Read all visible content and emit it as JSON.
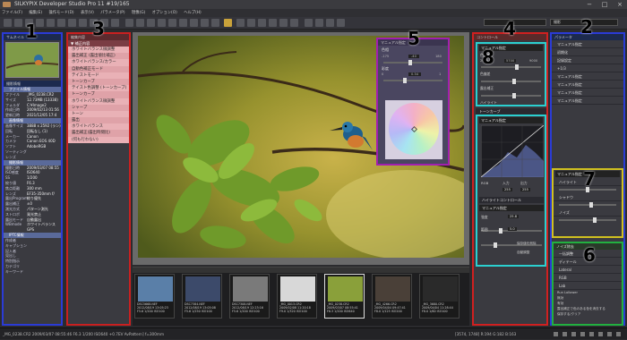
{
  "window": {
    "title": "SILKYPIX Developer Studio Pro 11  #19/165",
    "minimize": "−",
    "maximize": "□",
    "close": "×"
  },
  "menu": [
    "ファイル(F)",
    "編集(E)",
    "操作モード(D)",
    "表示(V)",
    "パラメータ(P)",
    "現像(G)",
    "オプション(O)",
    "ヘルプ(H)"
  ],
  "toolbar": {
    "combo_left": "",
    "combo_right": "撮影"
  },
  "callouts": [
    "1",
    "2",
    "3",
    "4",
    "5",
    "6",
    "7",
    "8"
  ],
  "thumbnail_panel": {
    "header": "サムネイル"
  },
  "info_panel": {
    "header": "撮影情報",
    "file_section": "ファイル情報",
    "file_rows": [
      {
        "k": "ファイル",
        "v": "_MG_0238.CR2"
      },
      {
        "k": "サイズ",
        "v": "12.73MB (13338)"
      },
      {
        "k": "フォルダ",
        "v": "C:¥Image2"
      },
      {
        "k": "作成日時",
        "v": "2009/02/13 01:56"
      },
      {
        "k": "更新日時",
        "v": "2021/12/05 17:4"
      }
    ],
    "image_section": "画像情報",
    "image_rows": [
      {
        "k": "画像サイズ",
        "v": "3888 x 2592 (ラン)"
      },
      {
        "k": "回転",
        "v": "回転なし (1)"
      },
      {
        "k": "メーカー",
        "v": "Canon"
      },
      {
        "k": "カメラ",
        "v": "Canon EOS 40D"
      },
      {
        "k": "ソフト",
        "v": "AdobeRGB"
      },
      {
        "k": "ソーティング",
        "v": ""
      },
      {
        "k": "レンズ",
        "v": ""
      }
    ],
    "shoot_section": "撮影情報",
    "shoot_rows": [
      {
        "k": "撮影日時",
        "v": "2009/03/07 08:55"
      },
      {
        "k": "ISO感度",
        "v": "ISO640"
      },
      {
        "k": "SS",
        "v": "1/200"
      },
      {
        "k": "絞り値",
        "v": "F6.3"
      },
      {
        "k": "焦点距離",
        "v": "300 mm"
      },
      {
        "k": "レンズ",
        "v": "EF35-350mm f/"
      },
      {
        "k": "露出Program",
        "v": "絞り優先"
      },
      {
        "k": "露出補正",
        "v": "±0"
      },
      {
        "k": "測光方式",
        "v": "パターン測光"
      },
      {
        "k": "ストロボ",
        "v": "発光禁止"
      },
      {
        "k": "露出モード",
        "v": "自動露出"
      },
      {
        "k": "WBmode",
        "v": "ホワイトバランス"
      },
      {
        "k": "",
        "v": "GPS"
      }
    ],
    "custom_section": "IPTC情報",
    "custom_rows": [
      {
        "k": "作成者",
        "v": ""
      },
      {
        "k": "キャプション",
        "v": ""
      },
      {
        "k": "記入者",
        "v": ""
      },
      {
        "k": "見出し",
        "v": ""
      },
      {
        "k": "特別指示",
        "v": ""
      },
      {
        "k": "カテゴリ",
        "v": ""
      },
      {
        "k": "キーワード",
        "v": ""
      }
    ]
  },
  "tree_panel": {
    "header": "編集内容",
    "subheader": "▼ 補正内容",
    "items": [
      "ホワイトバランス微調整",
      "露出補正 (露出値比補正)",
      "ホワイトバランス/カラー",
      "自動色補正モード",
      "テイストモード",
      "トーンカーブ",
      "テイスト色調整 (トーンカーブ)",
      "トーンカーブ",
      "ホワイトバランス微調整",
      "シャープ",
      "トーン",
      "露出",
      "ホワイトバランス",
      "露出補正(露出時間比)",
      "(何も行わない)"
    ]
  },
  "color_popup": {
    "header": "マニュアル指定",
    "hue_label": "色相",
    "hue_min": "-175",
    "hue_val": "-40",
    "hue_max": "180",
    "sat_label": "彩度",
    "sat_min": "0",
    "sat_val": "0.34",
    "sat_max": "1"
  },
  "dev_panel": {
    "header": "コントロール",
    "wb_label": "マニュアル指定",
    "temp_label": "色温度",
    "temp_val": "5700",
    "temp_min": "2000",
    "temp_max": "9000",
    "tint_label": "色偏差",
    "tint_val": "0",
    "exp_label": "露出補正",
    "exp_val": "0.00",
    "hl_label": "ハイライト",
    "tone_header": "トーンカーブ",
    "tone_mode": "マニュアル指定",
    "rgb_label": "RGB",
    "in_label": "入力",
    "out_label": "出力",
    "in_val": "255",
    "out_val": "255",
    "hl_header": "ハイライトコントロール",
    "hl_mode": "マニュアル指定",
    "hl_strength": "強度",
    "hl_strength_val": "25.8",
    "hl_range": "範囲",
    "hl_range_val": "5.0",
    "reset_label": "保存値を削除",
    "auto_label": "自動調整"
  },
  "params_panel": {
    "header": "パラメータ",
    "rows": [
      "マニュアル指定",
      "初期化",
      "記録設定",
      "+1/3",
      "マニュアル指定",
      "マニュアル指定",
      "マニュアル指定",
      "マニュアル指定"
    ],
    "sub_header": "マニュアル指定",
    "sub_rows": [
      "ハイライト",
      "シャドウ",
      "ノイズ"
    ],
    "nr_header": "ノイズ除去",
    "nr_rows": [
      "一括調整",
      "ディテール",
      "Lateral",
      "RGB",
      "Lab"
    ],
    "nr_bottom": [
      "Run Lollower",
      "無効",
      "有効",
      "露出補正で色のある色を消去する",
      "保存する/クリア"
    ]
  },
  "filmstrip": [
    {
      "name": "DSC5668.NEF",
      "date": "2012/08/19 13:05:23",
      "exif": "F5.6 1/200 ISO100"
    },
    {
      "name": "DSC7384.NEF",
      "date": "2012/08/19 13:05:08",
      "exif": "F5.6 1/250 ISO100"
    },
    {
      "name": "DSC7308.NEF",
      "date": "2012/08/19 12:23:16",
      "exif": "F5.6 1/200 ISO100"
    },
    {
      "name": "_MG_0013.CR2",
      "date": "2009/02/08 11:20:18",
      "exif": "F9.0 1/320 ISO100"
    },
    {
      "name": "_MG_0238.CR2",
      "date": "2009/03/07 08:55:41",
      "exif": "F6.3 1/200 ISO640"
    },
    {
      "name": "_MG_4266.CR2",
      "date": "2009/04/04 09:47:41",
      "exif": "F8.0 1/125 ISO200"
    },
    {
      "name": "_MG_3680.CR2",
      "date": "2009/04/04 11:28:44",
      "exif": "F8.0 1/60 ISO100"
    }
  ],
  "status": {
    "left": "_MG_0238.CR2 2009/03/07 08:55:46 F6.3 1/200 ISO640 +0.7EV AvPattern] f=300mm",
    "right": "[3574, 1748]  R:194  G:182  B:163"
  }
}
